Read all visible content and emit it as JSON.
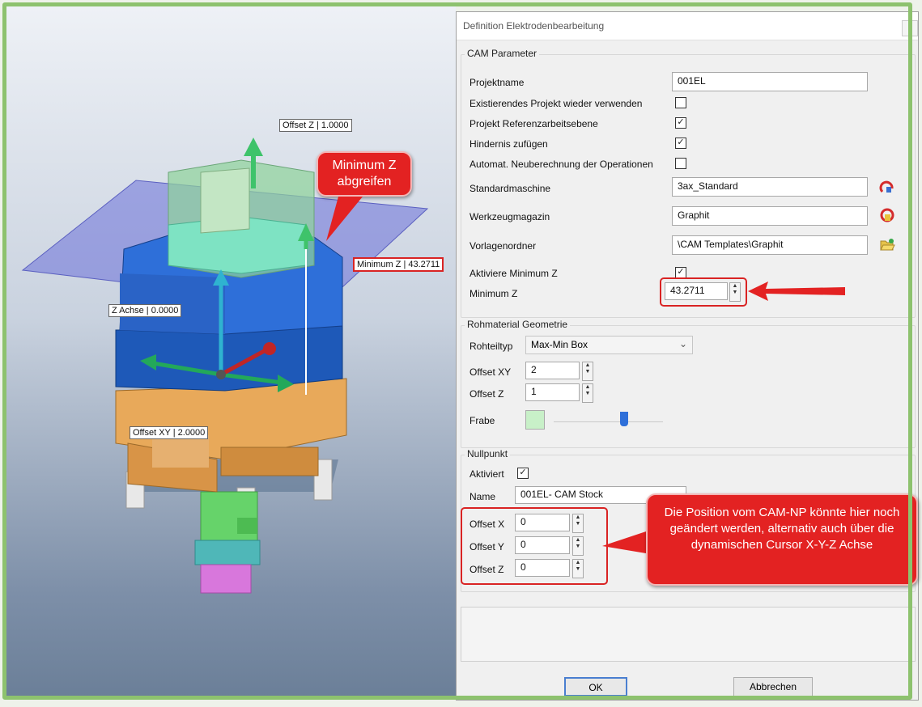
{
  "viewport": {
    "labels": {
      "offset_z": "Offset Z | 1.0000",
      "minimum_z": "Minimum Z | 43.2711",
      "z_achse": "Z Achse | 0.0000",
      "offset_xy": "Offset XY | 2.0000"
    },
    "callouts": {
      "top": "Minimum Z abgreifen",
      "bottom": "Die Position vom CAM-NP könnte hier noch geändert werden, alternativ auch über die dynamischen Cursor X-Y-Z Achse"
    }
  },
  "dialog": {
    "title": "Definition Elektrodenbearbeitung",
    "cam": {
      "group_title": "CAM Parameter",
      "projektname_label": "Projektname",
      "projektname_value": "001EL",
      "existierend_label": "Existierendes Projekt wieder verwenden",
      "existierend_checked": "",
      "referenz_label": "Projekt Referenzarbeitsebene",
      "referenz_checked": "✓",
      "hindernis_label": "Hindernis zufügen",
      "hindernis_checked": "✓",
      "automat_label": "Automat. Neuberechnung der Operationen",
      "automat_checked": "",
      "maschine_label": "Standardmaschine",
      "maschine_value": "3ax_Standard",
      "magazin_label": "Werkzeugmagazin",
      "magazin_value": "Graphit",
      "vorlage_label": "Vorlagenordner",
      "vorlage_value": "\\CAM Templates\\Graphit",
      "aktiviere_label": "Aktiviere Minimum Z",
      "aktiviere_checked": "✓",
      "minz_label": "Minimum Z",
      "minz_value": "43.2711"
    },
    "rohmaterial": {
      "group_title": "Rohmaterial Geometrie",
      "typ_label": "Rohteiltyp",
      "typ_value": "Max-Min Box",
      "offset_xy_label": "Offset XY",
      "offset_xy_value": "2",
      "offset_z_label": "Offset Z",
      "offset_z_value": "1",
      "farbe_label": "Frabe",
      "farbe_color": "#c8f0c8"
    },
    "nullpunkt": {
      "group_title": "Nullpunkt",
      "aktiviert_label": "Aktiviert",
      "aktiviert_checked": "✓",
      "name_label": "Name",
      "name_value": "001EL- CAM Stock",
      "offset_x_label": "Offset X",
      "offset_x_value": "0",
      "offset_y_label": "Offset Y",
      "offset_y_value": "0",
      "offset_z_label": "Offset Z",
      "offset_z_value": "0"
    },
    "buttons": {
      "ok": "OK",
      "cancel": "Abbrechen"
    }
  },
  "colors": {
    "accent_red": "#e32222",
    "border_green": "#8dc26e"
  },
  "icons": [
    "machine-icon",
    "tool-magazine-icon",
    "folder-open-icon",
    "close-icon",
    "spin-up-icon",
    "spin-down-icon",
    "chevron-down-icon"
  ]
}
